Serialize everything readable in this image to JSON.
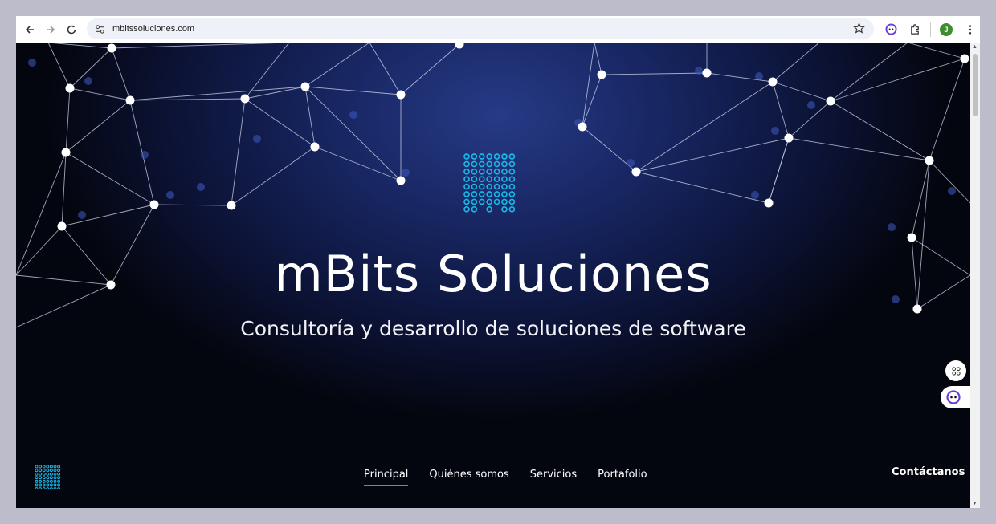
{
  "browser": {
    "url": "mbitssoluciones.com",
    "profile_initial": "J",
    "icons": [
      "back-icon",
      "forward-icon",
      "reload-icon",
      "site-settings-icon",
      "bookmark-star-icon",
      "extension-assistant-icon",
      "extensions-puzzle-icon",
      "menu-dots-icon"
    ]
  },
  "hero": {
    "title": "mBits Soluciones",
    "subtitle": "Consultoría y desarrollo de soluciones de software"
  },
  "nav": {
    "items": [
      {
        "label": "Principal",
        "active": true
      },
      {
        "label": "Quiénes somos",
        "active": false
      },
      {
        "label": "Servicios",
        "active": false
      },
      {
        "label": "Portafolio",
        "active": false
      }
    ],
    "contact_label": "Contáctanos"
  },
  "colors": {
    "accent_underline": "#19b88a",
    "logo_dots": "#19b7e6",
    "background_dark": "#0c1336",
    "background_glow": "#263a86"
  },
  "floating": [
    "apps-grid-icon",
    "assistant-face-icon"
  ]
}
